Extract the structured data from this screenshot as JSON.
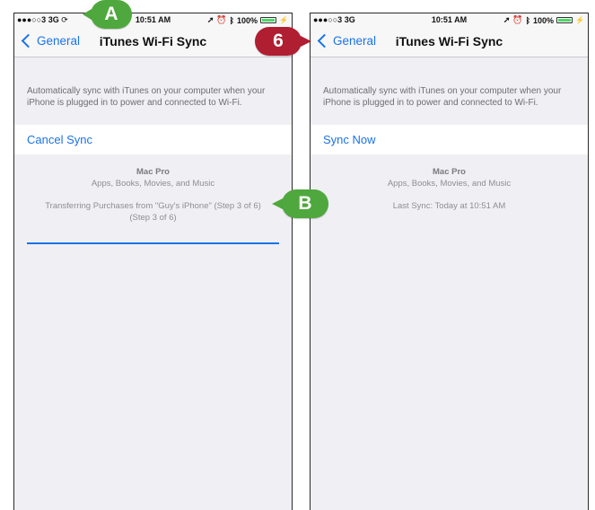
{
  "left": {
    "status": {
      "signal": "●●●○○3",
      "network": "3G",
      "sync_icon": "sync-icon",
      "time": "10:51 AM",
      "battery": "100%"
    },
    "nav": {
      "back_label": "General",
      "title": "iTunes Wi-Fi Sync"
    },
    "description": "Automatically sync with iTunes on your computer when your iPhone is plugged in to power and connected to Wi-Fi.",
    "action_label": "Cancel Sync",
    "device_name": "Mac Pro",
    "content_types": "Apps, Books, Movies, and Music",
    "status_line1": "Transferring Purchases from \"Guy's iPhone\" (Step 3 of 6)",
    "status_line2": "(Step 3 of 6)",
    "progress": 1.0
  },
  "right": {
    "status": {
      "signal": "●●●○○3",
      "network": "3G",
      "time": "10:51 AM",
      "battery": "100%"
    },
    "nav": {
      "back_label": "General",
      "title": "iTunes Wi-Fi Sync"
    },
    "description": "Automatically sync with iTunes on your computer when your iPhone is plugged in to power and connected to Wi-Fi.",
    "action_label": "Sync Now",
    "device_name": "Mac Pro",
    "content_types": "Apps, Books, Movies, and Music",
    "last_sync": "Last Sync: Today at 10:51 AM"
  },
  "callouts": {
    "a": "A",
    "b": "B",
    "six": "6"
  },
  "colors": {
    "accent": "#1a73e8",
    "callout_green": "#4fa83d",
    "callout_red": "#b01e32",
    "background": "#efeff4"
  }
}
